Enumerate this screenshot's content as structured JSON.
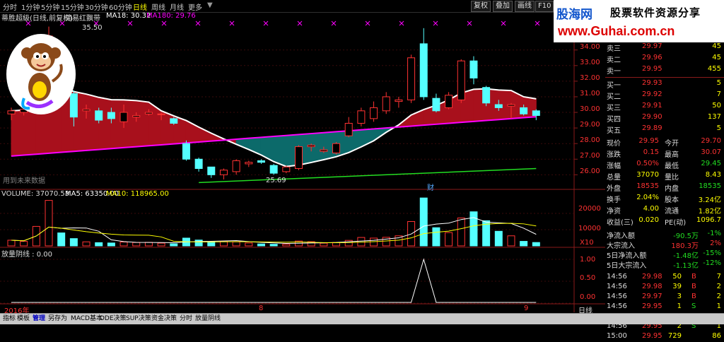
{
  "toolbar": {
    "timeframes": [
      "分时",
      "1分钟",
      "5分钟",
      "15分钟",
      "30分钟",
      "60分钟",
      "日线",
      "周线",
      "月线",
      "更多"
    ],
    "active_timeframe": "日线",
    "buttons": [
      "复权",
      "叠加",
      "画线",
      "F10",
      "标记"
    ]
  },
  "brand": {
    "name": "股海网",
    "slogan": "股票软件资源分享",
    "url": "www.Guhai.com.cn"
  },
  "chart_info": {
    "indicator": "蒂胜超級(日线,前复权)",
    "indicator2": "简易红飘带",
    "ma18": "MA18: 30.32",
    "ma180": "MA180: 29.76",
    "peak_label": "35.50",
    "low_label": "25.69",
    "future_label": "用到未来数据",
    "cai_mark": "财",
    "vol_title": "VOLUME: 37070.53",
    "vol_ma5": "MA5: 63350.00",
    "vol_ma10": "MA10: 118965.00",
    "vol_unit": "X10",
    "lower_title": "放量阴线 : 0.00",
    "date_start": "2016年",
    "date_mid": "8",
    "date_end": "9",
    "period": "日线"
  },
  "price_axis": [
    "34.00",
    "33.00",
    "32.00",
    "31.00",
    "30.00",
    "29.00",
    "28.00",
    "27.00",
    "26.00"
  ],
  "vol_axis": [
    "20000",
    "10000"
  ],
  "lower_axis": [
    "1.00",
    "0.50",
    "0.00"
  ],
  "chart_data": {
    "type": "candlestick",
    "candles": [
      {
        "o": 29.9,
        "c": 30.1,
        "h": 30.3,
        "l": 29.5
      },
      {
        "o": 30.0,
        "c": 30.2,
        "h": 30.4,
        "l": 29.8
      },
      {
        "o": 30.0,
        "c": 30.9,
        "h": 33.6,
        "l": 29.9
      },
      {
        "o": 31.6,
        "c": 34.9,
        "h": 35.5,
        "l": 31.0
      },
      {
        "o": 34.0,
        "c": 32.2,
        "h": 34.5,
        "l": 31.8
      },
      {
        "o": 31.2,
        "c": 29.7,
        "h": 31.4,
        "l": 29.1
      },
      {
        "o": 30.1,
        "c": 30.2,
        "h": 30.5,
        "l": 29.6
      },
      {
        "o": 30.1,
        "c": 29.5,
        "h": 30.3,
        "l": 29.3
      },
      {
        "o": 30.0,
        "c": 29.6,
        "h": 30.3,
        "l": 29.3
      },
      {
        "o": 29.4,
        "c": 30.0,
        "h": 30.5,
        "l": 29.0
      },
      {
        "o": 29.7,
        "c": 29.8,
        "h": 30.0,
        "l": 29.4
      },
      {
        "o": 29.9,
        "c": 30.0,
        "h": 30.2,
        "l": 29.8
      },
      {
        "o": 29.9,
        "c": 29.9,
        "h": 30.0,
        "l": 29.5
      },
      {
        "o": 29.6,
        "c": 29.3,
        "h": 29.7,
        "l": 29.2
      },
      {
        "o": 28.0,
        "c": 27.0,
        "h": 28.2,
        "l": 26.9
      },
      {
        "o": 27.0,
        "c": 26.4,
        "h": 27.1,
        "l": 26.2
      },
      {
        "o": 26.5,
        "c": 26.0,
        "h": 26.5,
        "l": 25.8
      },
      {
        "o": 26.0,
        "c": 26.3,
        "h": 26.4,
        "l": 25.7
      },
      {
        "o": 26.2,
        "c": 26.9,
        "h": 27.0,
        "l": 26.0
      },
      {
        "o": 26.7,
        "c": 26.8,
        "h": 26.9,
        "l": 26.5
      },
      {
        "o": 26.9,
        "c": 26.8,
        "h": 27.0,
        "l": 26.7
      },
      {
        "o": 26.6,
        "c": 26.1,
        "h": 26.7,
        "l": 26.0
      },
      {
        "o": 26.2,
        "c": 26.5,
        "h": 26.6,
        "l": 26.1
      },
      {
        "o": 26.4,
        "c": 27.8,
        "h": 27.9,
        "l": 26.3
      },
      {
        "o": 27.8,
        "c": 27.9,
        "h": 28.0,
        "l": 27.5
      },
      {
        "o": 27.5,
        "c": 27.6,
        "h": 27.8,
        "l": 27.4
      },
      {
        "o": 27.4,
        "c": 28.0,
        "h": 28.1,
        "l": 27.3
      },
      {
        "o": 28.5,
        "c": 29.3,
        "h": 29.7,
        "l": 28.4
      },
      {
        "o": 29.3,
        "c": 30.1,
        "h": 30.3,
        "l": 29.1
      },
      {
        "o": 29.6,
        "c": 30.3,
        "h": 30.7,
        "l": 29.4
      },
      {
        "o": 30.1,
        "c": 31.0,
        "h": 31.3,
        "l": 29.9
      },
      {
        "o": 30.7,
        "c": 30.8,
        "h": 31.0,
        "l": 30.3
      },
      {
        "o": 30.8,
        "c": 33.5,
        "h": 33.7,
        "l": 30.6
      },
      {
        "o": 34.4,
        "c": 31.0,
        "h": 35.4,
        "l": 30.8
      },
      {
        "o": 30.9,
        "c": 30.1,
        "h": 31.2,
        "l": 30.0
      },
      {
        "o": 30.3,
        "c": 31.1,
        "h": 31.3,
        "l": 30.2
      },
      {
        "o": 30.8,
        "c": 33.3,
        "h": 33.4,
        "l": 30.6
      },
      {
        "o": 33.3,
        "c": 32.2,
        "h": 33.6,
        "l": 31.8
      },
      {
        "o": 31.6,
        "c": 30.6,
        "h": 31.7,
        "l": 30.4
      },
      {
        "o": 30.5,
        "c": 30.3,
        "h": 30.8,
        "l": 30.1
      },
      {
        "o": 30.4,
        "c": 30.5,
        "h": 30.6,
        "l": 29.6
      },
      {
        "o": 30.3,
        "c": 29.9,
        "h": 30.5,
        "l": 29.8
      },
      {
        "o": 30.1,
        "c": 29.8,
        "h": 30.2,
        "l": 29.5
      }
    ],
    "volumes": [
      3500,
      2800,
      12000,
      28000,
      8000,
      4500,
      2500,
      2000,
      1800,
      2400,
      2100,
      2200,
      1700,
      1300,
      4800,
      3600,
      2600,
      2800,
      2500,
      1800,
      1200,
      1000,
      1100,
      3000,
      2600,
      1700,
      2100,
      3400,
      5200,
      4800,
      5300,
      6200,
      15000,
      29500,
      11200,
      8200,
      17200,
      21000,
      15500,
      9000,
      6200,
      2800,
      2100
    ],
    "price_ylim": [
      25.2,
      35.8
    ],
    "vol_ylim": [
      0,
      30000
    ]
  },
  "quote": {
    "sells": [
      {
        "label": "卖三",
        "price": "29.97",
        "vol": "45"
      },
      {
        "label": "卖二",
        "price": "29.96",
        "vol": "45"
      },
      {
        "label": "卖一",
        "price": "29.95",
        "vol": "455"
      }
    ],
    "buys": [
      {
        "label": "买一",
        "price": "29.93",
        "vol": "5"
      },
      {
        "label": "买二",
        "price": "29.92",
        "vol": "7"
      },
      {
        "label": "买三",
        "price": "29.91",
        "vol": "50"
      },
      {
        "label": "买四",
        "price": "29.90",
        "vol": "137"
      },
      {
        "label": "买五",
        "price": "29.89",
        "vol": "5"
      }
    ],
    "stats": [
      {
        "l1": "现价",
        "v1": "29.95",
        "l2": "今开",
        "v2": "29.70"
      },
      {
        "l1": "涨跌",
        "v1": "0.15",
        "l2": "最高",
        "v2": "30.07"
      },
      {
        "l1": "涨幅",
        "v1": "0.50%",
        "l2": "最低",
        "v2": "29.45"
      },
      {
        "l1": "总量",
        "v1": "37070",
        "l2": "量比",
        "v2": "8.43"
      },
      {
        "l1": "外盘",
        "v1": "18535",
        "l2": "内盘",
        "v2": "18535"
      },
      {
        "l1": "换手",
        "v1": "2.04%",
        "l2": "股本",
        "v2": "3.24亿"
      },
      {
        "l1": "净资",
        "v1": "4.00",
        "l2": "流通",
        "v2": "1.82亿"
      },
      {
        "l1": "收益(三)",
        "v1": "0.020",
        "l2": "PE(动)",
        "v2": "1096.7"
      }
    ],
    "flows": [
      {
        "label": "净流入额",
        "v1": "-90.5万",
        "v2": "-1%"
      },
      {
        "label": "大宗流入",
        "v1": "180.3万",
        "v2": "2%"
      },
      {
        "label": "5日净流入额",
        "v1": "-1.48亿",
        "v2": "-15%"
      },
      {
        "label": "5日大宗流入",
        "v1": "-1.13亿",
        "v2": "-12%"
      }
    ],
    "ticks": [
      {
        "time": "14:56",
        "price": "29.98",
        "vol": "50",
        "bs": "B",
        "n": "7"
      },
      {
        "time": "14:56",
        "price": "29.98",
        "vol": "39",
        "bs": "B",
        "n": "2"
      },
      {
        "time": "14:56",
        "price": "29.97",
        "vol": "3",
        "bs": "B",
        "n": "2"
      },
      {
        "time": "14:56",
        "price": "29.95",
        "vol": "1",
        "bs": "S",
        "n": "1"
      },
      {
        "time": "14:56",
        "price": "29.95",
        "vol": "1",
        "bs": "B",
        "n": "1"
      },
      {
        "time": "14:56",
        "price": "29.95",
        "vol": "2",
        "bs": "S",
        "n": "1"
      },
      {
        "time": "15:00",
        "price": "29.95",
        "vol": "729",
        "bs": "",
        "n": "86"
      }
    ]
  },
  "tabs": [
    "指标",
    "模板",
    "管理",
    "另存为",
    "MACD基本",
    "DDE决策",
    "SUP决策",
    "资金决策",
    "分时",
    "放量阴线"
  ],
  "active_tab": "管理",
  "colors": {
    "up": "#ff3232",
    "down": "#54ffff",
    "ribbon_red": "#a8101c",
    "ribbon_teal": "#0c6a6a",
    "ma_magenta": "#ff00ff",
    "line_green": "#22dd22"
  }
}
